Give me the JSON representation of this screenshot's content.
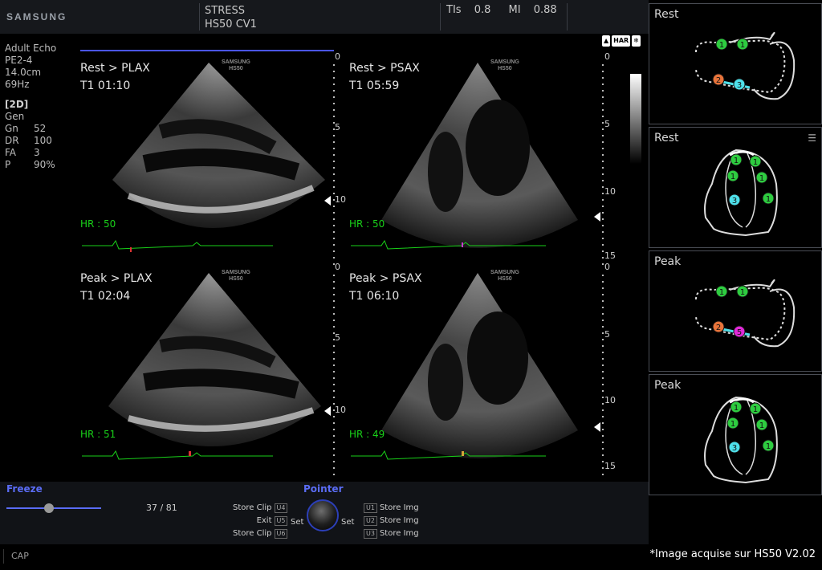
{
  "header": {
    "brand": "SAMSUNG",
    "mode_title": "STRESS",
    "device": "HS50 CV1",
    "tis_label": "TIs",
    "tis_value": "0.8",
    "mi_label": "MI",
    "mi_value": "0.88"
  },
  "parameters": {
    "preset": "Adult Echo",
    "probe": "PE2-4",
    "depth": "14.0cm",
    "frame_rate": "69Hz",
    "mode": "[2D]",
    "mode_sub": "Gen",
    "rows": [
      {
        "key": "Gn",
        "value": "52"
      },
      {
        "key": "DR",
        "value": "100"
      },
      {
        "key": "FA",
        "value": "3"
      },
      {
        "key": "P",
        "value": "90%"
      }
    ]
  },
  "images": [
    {
      "view": "Rest > PLAX",
      "time": "T1 01:10",
      "hr": "HR : 50",
      "brand": "SAMSUNG",
      "model": "HS50"
    },
    {
      "view": "Rest > PSAX",
      "time": "T1 05:59",
      "hr": "HR : 50",
      "brand": "SAMSUNG",
      "model": "HS50"
    },
    {
      "view": "Peak > PLAX",
      "time": "T1 02:04",
      "hr": "HR : 51",
      "brand": "SAMSUNG",
      "model": "HS50"
    },
    {
      "view": "Peak > PSAX",
      "time": "T1 06:10",
      "hr": "HR : 49",
      "brand": "SAMSUNG",
      "model": "HS50"
    }
  ],
  "depth_scale": {
    "upper_ticks": [
      "0",
      "5",
      "10"
    ],
    "lower_ticks": [
      "0",
      "5",
      "10",
      "15"
    ],
    "right_upper_ticks": [
      "0",
      "5",
      "10",
      "15"
    ]
  },
  "toolbar_icons": [
    "HAR",
    "❄"
  ],
  "segment_panels": [
    {
      "title": "Rest",
      "type": "plax",
      "scores": [
        "1",
        "1",
        "2",
        "3"
      ]
    },
    {
      "title": "Rest",
      "type": "4ch",
      "scores": [
        "1",
        "1",
        "1",
        "1",
        "3",
        "1"
      ]
    },
    {
      "title": "Peak",
      "type": "plax",
      "scores": [
        "1",
        "1",
        "2",
        "5"
      ]
    },
    {
      "title": "Peak",
      "type": "4ch",
      "scores": [
        "1",
        "1",
        "1",
        "1",
        "3",
        "1"
      ]
    }
  ],
  "score_colors": {
    "1": "#2ecc40",
    "2": "#e8743b",
    "3": "#4ee0ea",
    "5": "#e02ad8"
  },
  "bottom": {
    "freeze_label": "Freeze",
    "pointer_label": "Pointer",
    "frame_counter": "37 / 81",
    "freeze_progress": 0.45,
    "left_buttons": [
      {
        "label": "Store Clip",
        "key": "U4"
      },
      {
        "label": "Exit",
        "key": "U5"
      },
      {
        "label": "Store Clip",
        "key": "U6"
      }
    ],
    "right_buttons": [
      {
        "label": "Store Img",
        "key": "U1"
      },
      {
        "label": "Store Img",
        "key": "U2"
      },
      {
        "label": "Store Img",
        "key": "U3"
      }
    ],
    "set_left": "Set",
    "set_right": "Set",
    "cap_label": "CAP",
    "notice": "*Image acquise sur HS50 V2.02"
  }
}
